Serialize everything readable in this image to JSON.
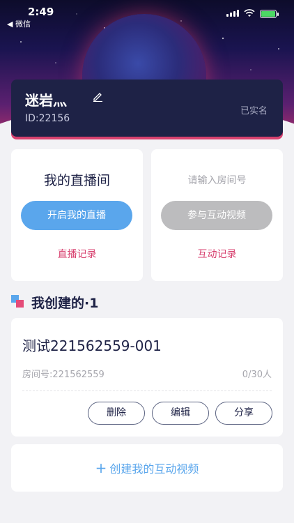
{
  "status_bar": {
    "time": "2:49",
    "back_label": "◀ 微信"
  },
  "profile": {
    "name": "迷岩灬",
    "id": "ID:22156",
    "verified": "已实名"
  },
  "live_room": {
    "title": "我的直播间",
    "start_button": "开启我的直播",
    "history_link": "直播记录"
  },
  "join_room": {
    "placeholder": "请输入房间号",
    "join_button": "参与互动视频",
    "history_link": "互动记录"
  },
  "section": {
    "title": "我创建的·1"
  },
  "rooms": [
    {
      "name": "测试221562559-001",
      "room_number": "房间号:221562559",
      "capacity": "0/30人",
      "delete_label": "删除",
      "edit_label": "编辑",
      "share_label": "分享"
    }
  ],
  "create": {
    "label": "创建我的互动视频"
  },
  "colors": {
    "accent_blue": "#5aa6ec",
    "accent_pink": "#d8416f",
    "card_dark": "#1e2246"
  }
}
